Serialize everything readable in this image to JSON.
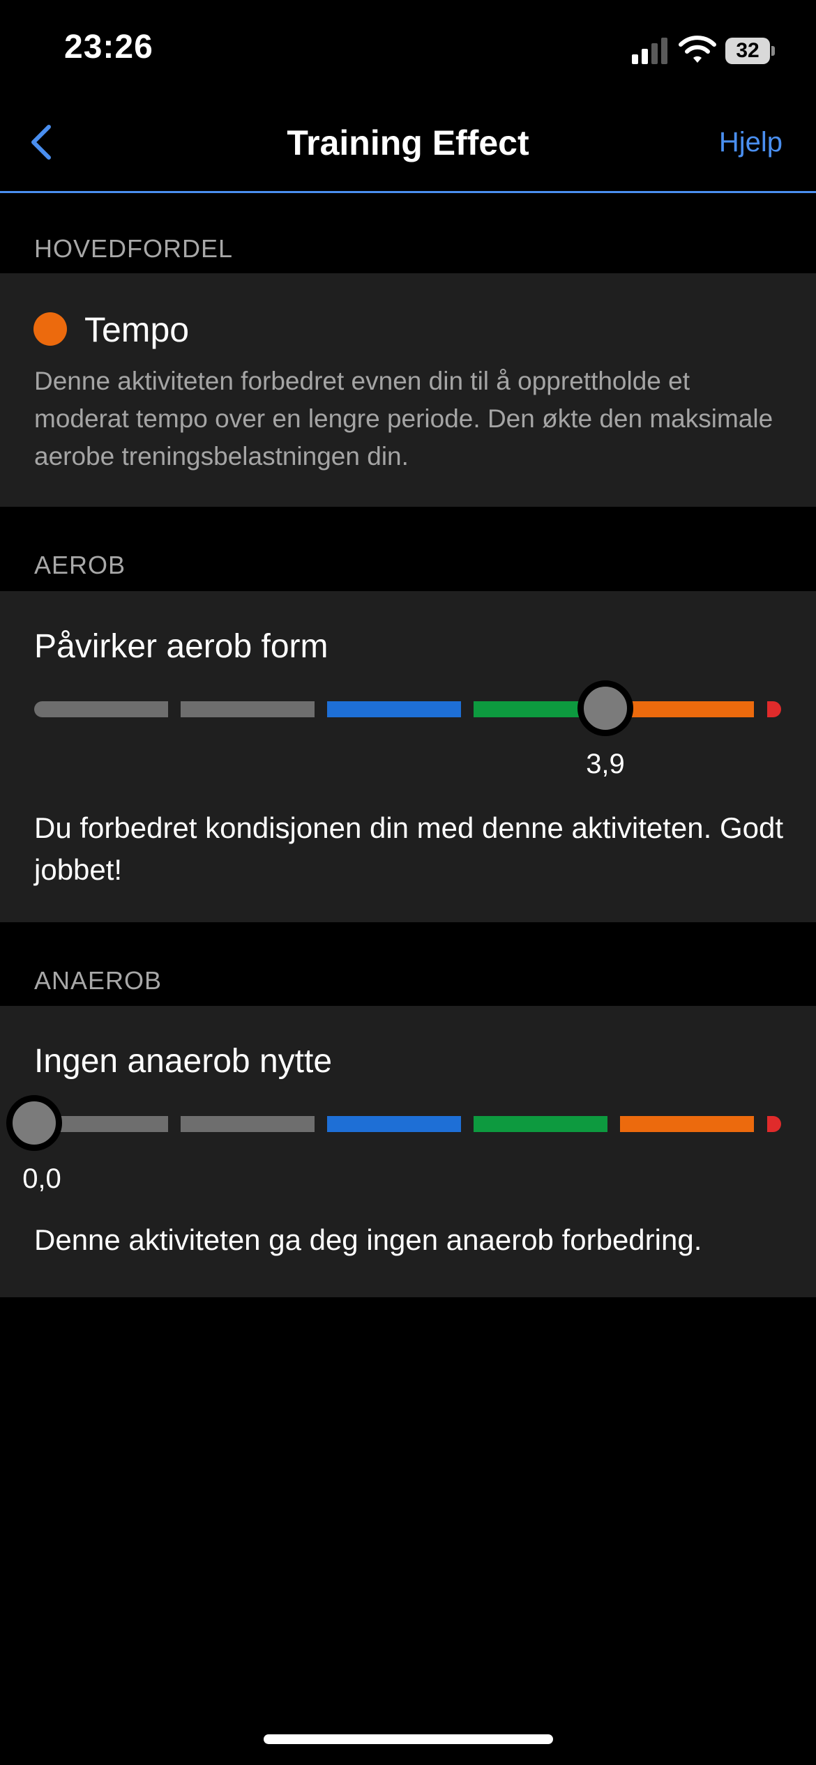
{
  "status_bar": {
    "time": "23:26",
    "battery_level": "32",
    "signal_bars": 2,
    "signal_max": 4
  },
  "nav": {
    "title": "Training Effect",
    "help_label": "Hjelp",
    "back_icon": "chevron-left-icon"
  },
  "colors": {
    "accent": "#4a8ff0",
    "orange": "#ec6a0d",
    "gray": "#6e6e6e",
    "blue": "#1e6fd6",
    "green": "#0d9a3f",
    "red": "#e02b2b"
  },
  "primary_benefit": {
    "header": "HOVEDFORDEL",
    "title": "Tempo",
    "description": "Denne aktiviteten forbedret evnen din til å opprettholde et moderat tempo over en lengre periode. Den økte den maksimale aerobe treningsbelastningen din."
  },
  "aerobic": {
    "header": "AEROB",
    "title": "Påvirker aerob form",
    "value": 3.9,
    "value_label": "3,9",
    "description": "Du forbedret kondisjonen din med denne aktiviteten. Godt jobbet!"
  },
  "anaerobic": {
    "header": "ANAEROB",
    "title": "Ingen anaerob nytte",
    "value": 0.0,
    "value_label": "0,0",
    "description": "Denne aktiviteten ga deg ingen anaerob forbedring."
  },
  "scale": {
    "min": 0,
    "max": 5,
    "segment_colors": [
      "gray",
      "gray",
      "blue",
      "green",
      "orange",
      "red"
    ]
  }
}
